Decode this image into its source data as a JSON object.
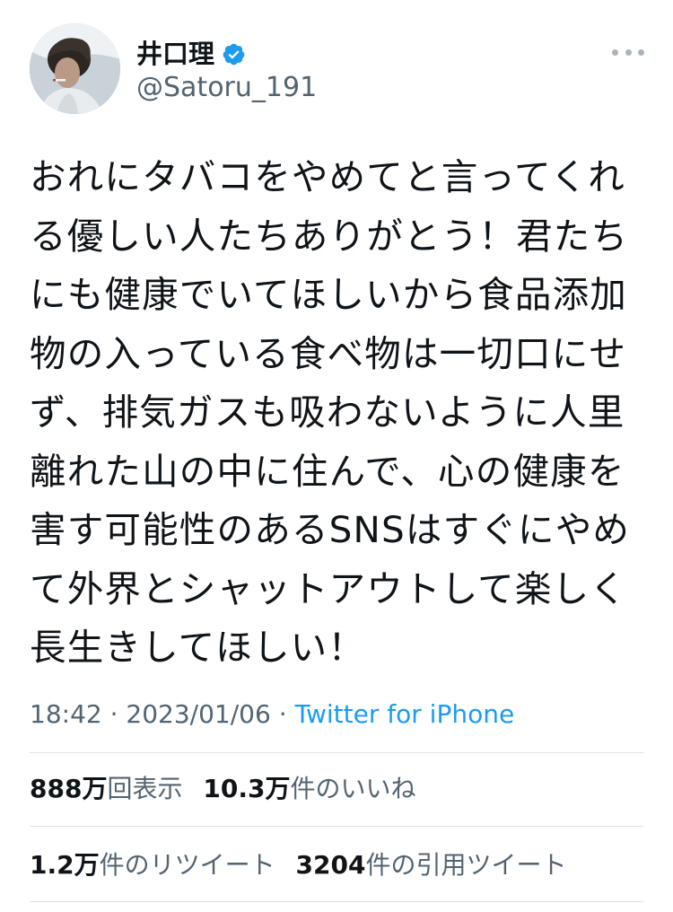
{
  "header": {
    "display_name": "井口理",
    "handle": "@Satoru_191"
  },
  "icons": {
    "avatar": "profile-photo",
    "verified": "verified-badge-icon",
    "more": "more-horizontal-icon"
  },
  "colors": {
    "accent": "#1d9bf0",
    "text": "#0f1419",
    "secondary": "#536471"
  },
  "tweet": {
    "lines": [
      "おれにタバコをやめてと言ってくれ",
      "る優しい人たちありがとう！君たち",
      "にも健康でいてほしいから食品添加",
      "物の入っている食べ物は一切口にせ",
      "ず、排気ガスも吸わないように人里",
      "離れた山の中に住んで、心の健康を",
      "害す可能性のあるSNSはすぐにやめ",
      "て外界とシャットアウトして楽しく",
      "長生きしてほしい！"
    ]
  },
  "meta": {
    "time": "18:42",
    "separator": "·",
    "date": "2023/01/06",
    "source": "Twitter for iPhone"
  },
  "stats": {
    "views_count": "888万",
    "views_label": "回表示",
    "likes_count": "10.3万",
    "likes_label": "件のいいね",
    "retweets_count": "1.2万",
    "retweets_label": "件のリツイート",
    "quotes_count": "3204",
    "quotes_label": "件の引用ツイート"
  }
}
